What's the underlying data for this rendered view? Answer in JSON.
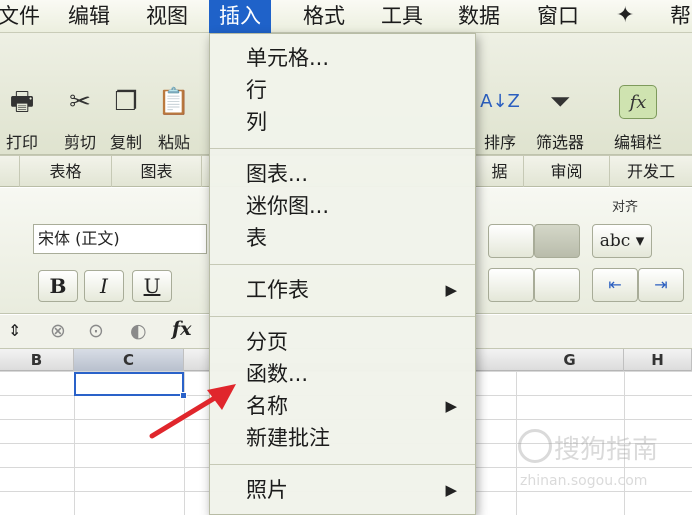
{
  "menubar": {
    "items": [
      "文件",
      "编辑",
      "视图",
      "插入",
      "格式",
      "工具",
      "数据",
      "窗口",
      "帮"
    ],
    "active_index": 3
  },
  "toolbar": {
    "buttons": [
      "打印",
      "剪切",
      "复制",
      "粘贴",
      "排序",
      "筛选器",
      "编辑栏"
    ]
  },
  "ribbon": {
    "tabs": [
      "表格",
      "图表",
      "据",
      "审阅",
      "开发工"
    ]
  },
  "format_panel": {
    "align_title": "对齐",
    "font_name": "宋体 (正文)",
    "bold_label": "B",
    "italic_label": "I",
    "underline_label": "U",
    "wrap_label": "abc"
  },
  "formula_bar": {
    "fx_label": "fx"
  },
  "grid": {
    "columns": [
      "B",
      "C",
      "G",
      "H"
    ],
    "selected_column": "C"
  },
  "dropdown": {
    "items": [
      {
        "label": "单元格...",
        "submenu": false
      },
      {
        "label": "行",
        "submenu": false
      },
      {
        "label": "列",
        "submenu": false
      },
      {
        "label": "图表...",
        "submenu": false
      },
      {
        "label": "迷你图...",
        "submenu": false
      },
      {
        "label": "表",
        "submenu": false
      },
      {
        "label": "工作表",
        "submenu": true
      },
      {
        "label": "分页",
        "submenu": false
      },
      {
        "label": "函数...",
        "submenu": false
      },
      {
        "label": "名称",
        "submenu": true
      },
      {
        "label": "新建批注",
        "submenu": false
      },
      {
        "label": "照片",
        "submenu": true
      }
    ]
  },
  "watermark": {
    "main": "搜狗指南",
    "sub": "zhinan.sogou.com"
  },
  "colors": {
    "menu_highlight": "#1f62c9",
    "selection_border": "#2a62c9",
    "pointer_arrow": "#e0262c"
  }
}
